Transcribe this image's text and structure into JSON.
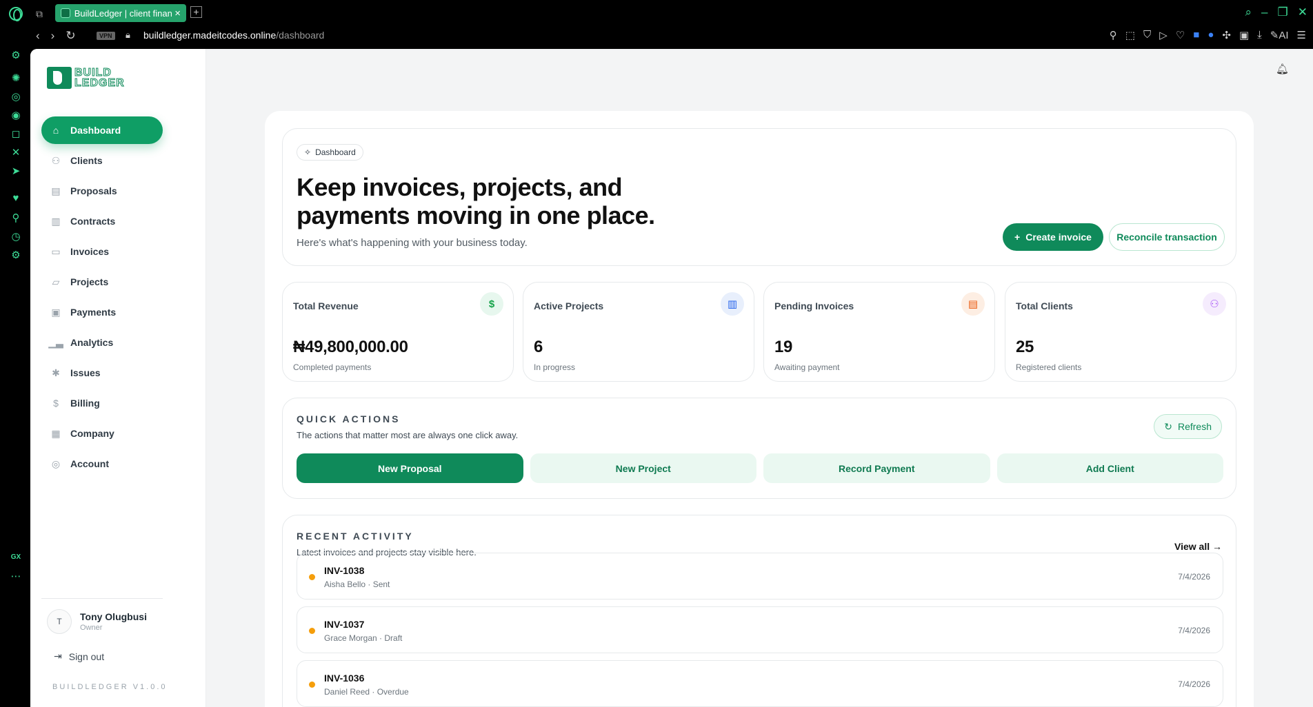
{
  "browser": {
    "tab_title": "BuildLedger | client finan",
    "url_domain": "buildledger.madeitcodes.online",
    "url_path": "/dashboard",
    "vpn_label": "VPN",
    "sidebar_bottom_label": "GX",
    "ai_label": "AI"
  },
  "brand": {
    "line1": "BUILD",
    "line2": "LEDGER",
    "color": "#0f8a5a"
  },
  "nav": [
    {
      "label": "Dashboard",
      "icon": "home-icon"
    },
    {
      "label": "Clients",
      "icon": "users-icon"
    },
    {
      "label": "Proposals",
      "icon": "document-icon"
    },
    {
      "label": "Contracts",
      "icon": "briefcase-icon"
    },
    {
      "label": "Invoices",
      "icon": "card-icon"
    },
    {
      "label": "Projects",
      "icon": "folder-icon"
    },
    {
      "label": "Payments",
      "icon": "wallet-icon"
    },
    {
      "label": "Analytics",
      "icon": "bar-chart-icon"
    },
    {
      "label": "Issues",
      "icon": "bug-icon"
    },
    {
      "label": "Billing",
      "icon": "dollar-circle-icon"
    },
    {
      "label": "Company",
      "icon": "building-icon"
    },
    {
      "label": "Account",
      "icon": "user-circle-icon"
    }
  ],
  "user": {
    "initial": "T",
    "name": "Tony Olugbusi",
    "role": "Owner",
    "signout": "Sign out"
  },
  "version": "BUILDLEDGER V1.0.0",
  "hero": {
    "pill": "Dashboard",
    "title": "Keep invoices, projects, and payments moving in one place.",
    "subtitle": "Here's what's happening with your business today.",
    "create_invoice": "Create invoice",
    "reconcile": "Reconcile transaction"
  },
  "stats": [
    {
      "label": "Total Revenue",
      "value": "₦49,800,000.00",
      "note": "Completed payments",
      "icon": "dollar-icon",
      "color": "#16a34a",
      "bg": "#e7f7ee"
    },
    {
      "label": "Active Projects",
      "value": "6",
      "note": "In progress",
      "icon": "briefcase-icon",
      "color": "#2563eb",
      "bg": "#e8effc"
    },
    {
      "label": "Pending Invoices",
      "value": "19",
      "note": "Awaiting payment",
      "icon": "file-icon",
      "color": "#ea580c",
      "bg": "#fdeee3"
    },
    {
      "label": "Total Clients",
      "value": "25",
      "note": "Registered clients",
      "icon": "users-icon",
      "color": "#a855f7",
      "bg": "#f5ecfd"
    }
  ],
  "quick_actions": {
    "title": "QUICK ACTIONS",
    "subtitle": "The actions that matter most are always one click away.",
    "refresh": "Refresh",
    "buttons": [
      "New Proposal",
      "New Project",
      "Record Payment",
      "Add Client"
    ]
  },
  "recent_activity": {
    "title": "RECENT ACTIVITY",
    "subtitle": "Latest invoices and projects stay visible here.",
    "view_all": "View all",
    "items": [
      {
        "id": "INV-1038",
        "detail": "Aisha Bello · Sent",
        "date": "7/4/2026"
      },
      {
        "id": "INV-1037",
        "detail": "Grace Morgan · Draft",
        "date": "7/4/2026"
      },
      {
        "id": "INV-1036",
        "detail": "Daniel Reed · Overdue",
        "date": "7/4/2026"
      }
    ]
  },
  "colors": {
    "accent": "#0f8a5a",
    "status_dot": "#f59e0b"
  }
}
